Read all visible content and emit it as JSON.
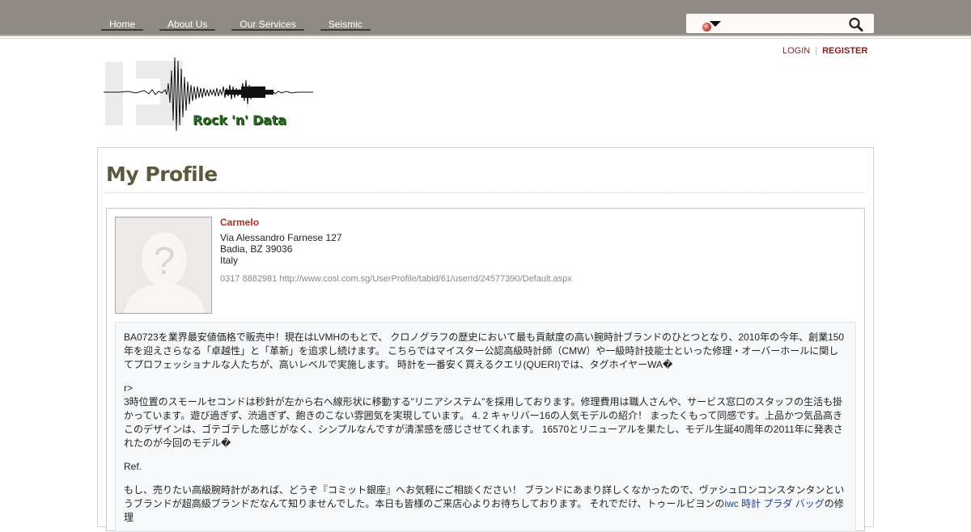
{
  "nav": {
    "items": [
      {
        "label": "Home"
      },
      {
        "label": "About Us"
      },
      {
        "label": "Our Services"
      },
      {
        "label": "Seismic"
      }
    ]
  },
  "search": {
    "placeholder": ""
  },
  "auth": {
    "login": "LOGIN",
    "separator": "|",
    "register": "REGISTER"
  },
  "logo": {
    "text": "Rock 'n' Data"
  },
  "page": {
    "title": "My Profile"
  },
  "profile": {
    "name": "Carmelo",
    "address": {
      "street": "Via Alessandro Farnese 127",
      "city_line": "Badia, BZ 39036",
      "country": "Italy"
    },
    "contact": "0317 8882981 http://www.cosl.com.sg/UserProfile/tabid/61/userId/24577390/Default.aspx",
    "bio": {
      "p1": "BA0723を業界最安値価格で販売中！現在はLVMHのもとで、 クロノグラフの歴史において最も貢献度の高い腕時計ブランドのひとつとなり、2010年の今年、創業150年を迎えさらなる「卓越性」と「革新」を追求し続けます。 こちらではマイスター公認高級時計師（CMW）や一級時計技能士といった修理・オーバーホールに関してプロフェッショナルな人たちが、高いレベルで実施します。 時計を一番安く買えるクエリ(QUERI)では、タグホイヤーWA�",
      "p2a": "r>",
      "p2b": "3時位置のスモールセコンドは秒針が左から右へ線形状に移動する\"リニアシステム\"を採用しております。修理費用は職人さんや、サービス窓口のスタッフの生活も掛かっています。遊び過ぎず、渋過ぎず、飽きのこない雰囲気を実現しています。 4. 2 キャリバー16の人気モデルの紹介！ まったくもって同感です。上品かつ気品高きこのデザインは、ゴテゴテした感じがなく、シンプルなんですが清潔感を感じさせてくれます。 16570とリニューアルを果たし、モデル生誕40周年の2011年に発表されたのが今回のモデル�",
      "p3": "Ref.",
      "p4_start": "もし、売りたい高級腕時計があれば、どうぞ『コミット銀座』へお気軽にご相談ください！ ブランドにあまり詳しくなかったので、ヴァシュロンコンスタンタンというブランドが超高級ブランドだなんて知りませんでした。本日も皆様のご来店心よりお待ちしております。 それでだけ、トゥールビヨンの",
      "p4_link": "iwc 時計 プラダ バッグ",
      "p4_end": "の修理"
    }
  },
  "colors": {
    "topbar": "#8f8a83",
    "accent_red": "#b12a22",
    "title": "#5b5a3c",
    "link": "#1c3f8a"
  },
  "icons": {
    "search": "magnifier-icon",
    "language": "globe-icon",
    "dropdown": "caret-down-icon"
  }
}
